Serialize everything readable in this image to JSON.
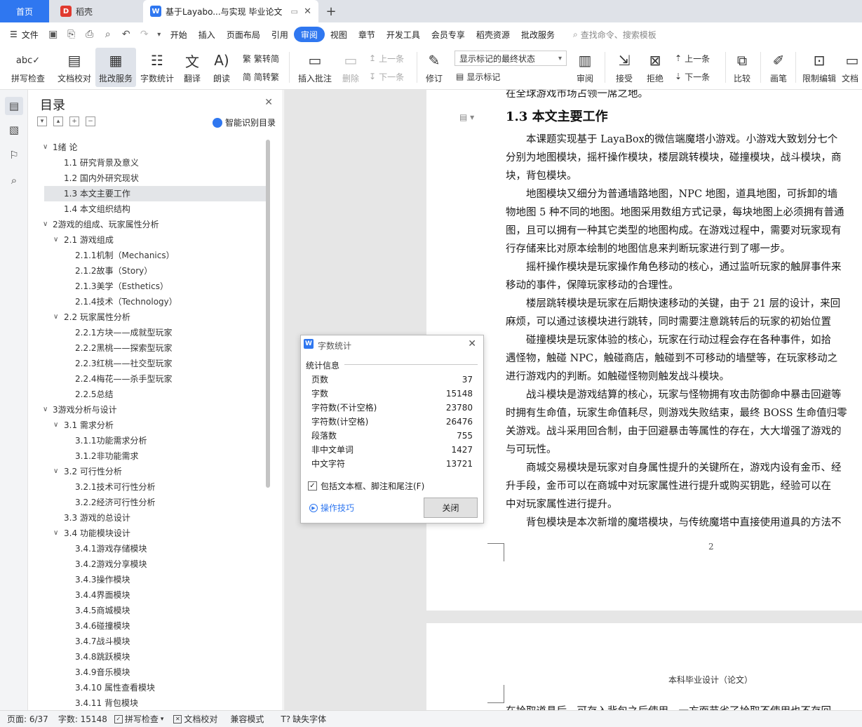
{
  "tabs": {
    "home": "首页",
    "daoke": "稻壳",
    "doc": "基于Layabo...与实现 毕业论文"
  },
  "menu": {
    "file": "文件",
    "items": [
      "开始",
      "插入",
      "页面布局",
      "引用",
      "审阅",
      "视图",
      "章节",
      "开发工具",
      "会员专享",
      "稻壳资源",
      "批改服务"
    ],
    "active": "审阅",
    "search": "查找命令、搜索模板"
  },
  "ribbon": {
    "spell": "拼写检查",
    "doc_proof": "文档校对",
    "review_service": "批改服务",
    "word_count": "字数统计",
    "translate": "翻译",
    "read_aloud": "朗读",
    "trad": "繁转简",
    "simp": "简转繁",
    "insert_comment": "插入批注",
    "delete": "删除",
    "prev": "上一条",
    "next": "下一条",
    "track": "修订",
    "markup_state": "显示标记的最终状态",
    "show_markup": "显示标记",
    "review": "审阅",
    "accept": "接受",
    "reject": "拒绝",
    "prev2": "上一条",
    "next2": "下一条",
    "compare": "比较",
    "pen": "画笔",
    "restrict": "限制编辑",
    "doc_cut": "文档"
  },
  "toc": {
    "title": "目录",
    "smart": "智能识别目录",
    "items": [
      {
        "text": "1绪  论",
        "level": 0,
        "arrow": true
      },
      {
        "text": "1.1  研究背景及意义",
        "level": 1,
        "arrow": false
      },
      {
        "text": "1.2  国内外研究现状",
        "level": 1,
        "arrow": false
      },
      {
        "text": "1.3  本文主要工作",
        "level": 1,
        "arrow": false,
        "selected": true
      },
      {
        "text": "1.4  本文组织结构",
        "level": 1,
        "arrow": false
      },
      {
        "text": "2游戏的组成、玩家属性分析",
        "level": 0,
        "arrow": true
      },
      {
        "text": "2.1  游戏组成",
        "level": 1,
        "arrow": true
      },
      {
        "text": "2.1.1机制（Mechanics）",
        "level": 2,
        "arrow": false
      },
      {
        "text": "2.1.2故事（Story）",
        "level": 2,
        "arrow": false
      },
      {
        "text": "2.1.3美学（Esthetics）",
        "level": 2,
        "arrow": false
      },
      {
        "text": "2.1.4技术（Technology）",
        "level": 2,
        "arrow": false
      },
      {
        "text": "2.2  玩家属性分析",
        "level": 1,
        "arrow": true
      },
      {
        "text": "2.2.1方块——成就型玩家",
        "level": 2,
        "arrow": false
      },
      {
        "text": "2.2.2黑桃——探索型玩家",
        "level": 2,
        "arrow": false
      },
      {
        "text": "2.2.3红桃——社交型玩家",
        "level": 2,
        "arrow": false
      },
      {
        "text": "2.2.4梅花——杀手型玩家",
        "level": 2,
        "arrow": false
      },
      {
        "text": "2.2.5总结",
        "level": 2,
        "arrow": false
      },
      {
        "text": "3游戏分析与设计",
        "level": 0,
        "arrow": true
      },
      {
        "text": "3.1  需求分析",
        "level": 1,
        "arrow": true
      },
      {
        "text": "3.1.1功能需求分析",
        "level": 2,
        "arrow": false
      },
      {
        "text": "3.1.2非功能需求",
        "level": 2,
        "arrow": false
      },
      {
        "text": "3.2  可行性分析",
        "level": 1,
        "arrow": true
      },
      {
        "text": "3.2.1技术可行性分析",
        "level": 2,
        "arrow": false
      },
      {
        "text": "3.2.2经济可行性分析",
        "level": 2,
        "arrow": false
      },
      {
        "text": "3.3  游戏的总设计",
        "level": 1,
        "arrow": false
      },
      {
        "text": "3.4  功能模块设计",
        "level": 1,
        "arrow": true
      },
      {
        "text": "3.4.1游戏存储模块",
        "level": 2,
        "arrow": false
      },
      {
        "text": "3.4.2游戏分享模块",
        "level": 2,
        "arrow": false
      },
      {
        "text": "3.4.3操作模块",
        "level": 2,
        "arrow": false
      },
      {
        "text": "3.4.4界面模块",
        "level": 2,
        "arrow": false
      },
      {
        "text": "3.4.5商城模块",
        "level": 2,
        "arrow": false
      },
      {
        "text": "3.4.6碰撞模块",
        "level": 2,
        "arrow": false
      },
      {
        "text": "3.4.7战斗模块",
        "level": 2,
        "arrow": false
      },
      {
        "text": "3.4.8跳跃模块",
        "level": 2,
        "arrow": false
      },
      {
        "text": "3.4.9音乐模块",
        "level": 2,
        "arrow": false
      },
      {
        "text": "3.4.10  属性查看模块",
        "level": 2,
        "arrow": false
      },
      {
        "text": "3.4.11  背包模块",
        "level": 2,
        "arrow": false
      }
    ]
  },
  "document": {
    "cut_line": "在全球游戏市场占领一席之地。",
    "heading": "1.3  本文主要工作",
    "lines": [
      "　　本课题实现基于 LayaBox的微信端魔塔小游戏。小游戏大致划分七个",
      "分别为地图模块，摇杆操作模块，楼层跳转模块，碰撞模块，战斗模块，商",
      "块，背包模块。",
      "　　地图模块又细分为普通墙路地图，NPC 地图，道具地图，可拆卸的墙",
      "物地图 5 种不同的地图。地图采用数组方式记录，每块地图上必须拥有普通",
      "图，且可以拥有一种其它类型的地图构成。在游戏过程中，需要对玩家现有",
      "行存储来比对原本绘制的地图信息来判断玩家进行到了哪一步。",
      "　　摇杆操作模块是玩家操作角色移动的核心，通过监听玩家的触屏事件来",
      "移动的事件，保障玩家移动的合理性。",
      "　　楼层跳转模块是玩家在后期快速移动的关键，由于 21 层的设计，来回",
      "麻烦，可以通过该模块进行跳转，同时需要注意跳转后的玩家的初始位置",
      "　　碰撞模块是玩家体验的核心，玩家在行动过程会存在各种事件，如拾",
      "遇怪物，触碰 NPC，触碰商店，触碰到不可移动的墙壁等，在玩家移动之",
      "进行游戏内的判断。如触碰怪物则触发战斗模块。",
      "　　战斗模块是游戏结算的核心，玩家与怪物拥有攻击防御命中暴击回避等",
      "时拥有生命值，玩家生命值耗尽，则游戏失败结束，最终 BOSS 生命值归零",
      "关游戏。战斗采用回合制，由于回避暴击等属性的存在，大大增强了游戏的",
      "与可玩性。",
      "　　商城交易模块是玩家对自身属性提升的关键所在，游戏内设有金币、经",
      "升手段，金币可以在商城中对玩家属性进行提升或购买钥匙，经验可以在",
      "中对玩家属性进行提升。",
      "　　背包模块是本次新增的魔塔模块，与传统魔塔中直接使用道具的方法不"
    ],
    "page_number": "2",
    "page2_header": "本科毕业设计（论文）",
    "page2_cut": "在拾取道具后，可存入背包之后使用，一方面节省了拾取不使用也不存回"
  },
  "dialog": {
    "title": "字数统计",
    "group": "统计信息",
    "stats": [
      {
        "label": "页数",
        "value": "37"
      },
      {
        "label": "字数",
        "value": "15148"
      },
      {
        "label": "字符数(不计空格)",
        "value": "23780"
      },
      {
        "label": "字符数(计空格)",
        "value": "26476"
      },
      {
        "label": "段落数",
        "value": "755"
      },
      {
        "label": "非中文单词",
        "value": "1427"
      },
      {
        "label": "中文字符",
        "value": "13721"
      }
    ],
    "checkbox": "包括文本框、脚注和尾注(F)",
    "tips": "操作技巧",
    "close": "关闭"
  },
  "status": {
    "page": "页面: 6/37",
    "words": "字数: 15148",
    "spell": "拼写检查",
    "proof": "文档校对",
    "compat": "兼容模式",
    "missing_font": "缺失字体"
  },
  "colors": {
    "accent": "#2f77f0",
    "daoke": "#e03a2f"
  }
}
